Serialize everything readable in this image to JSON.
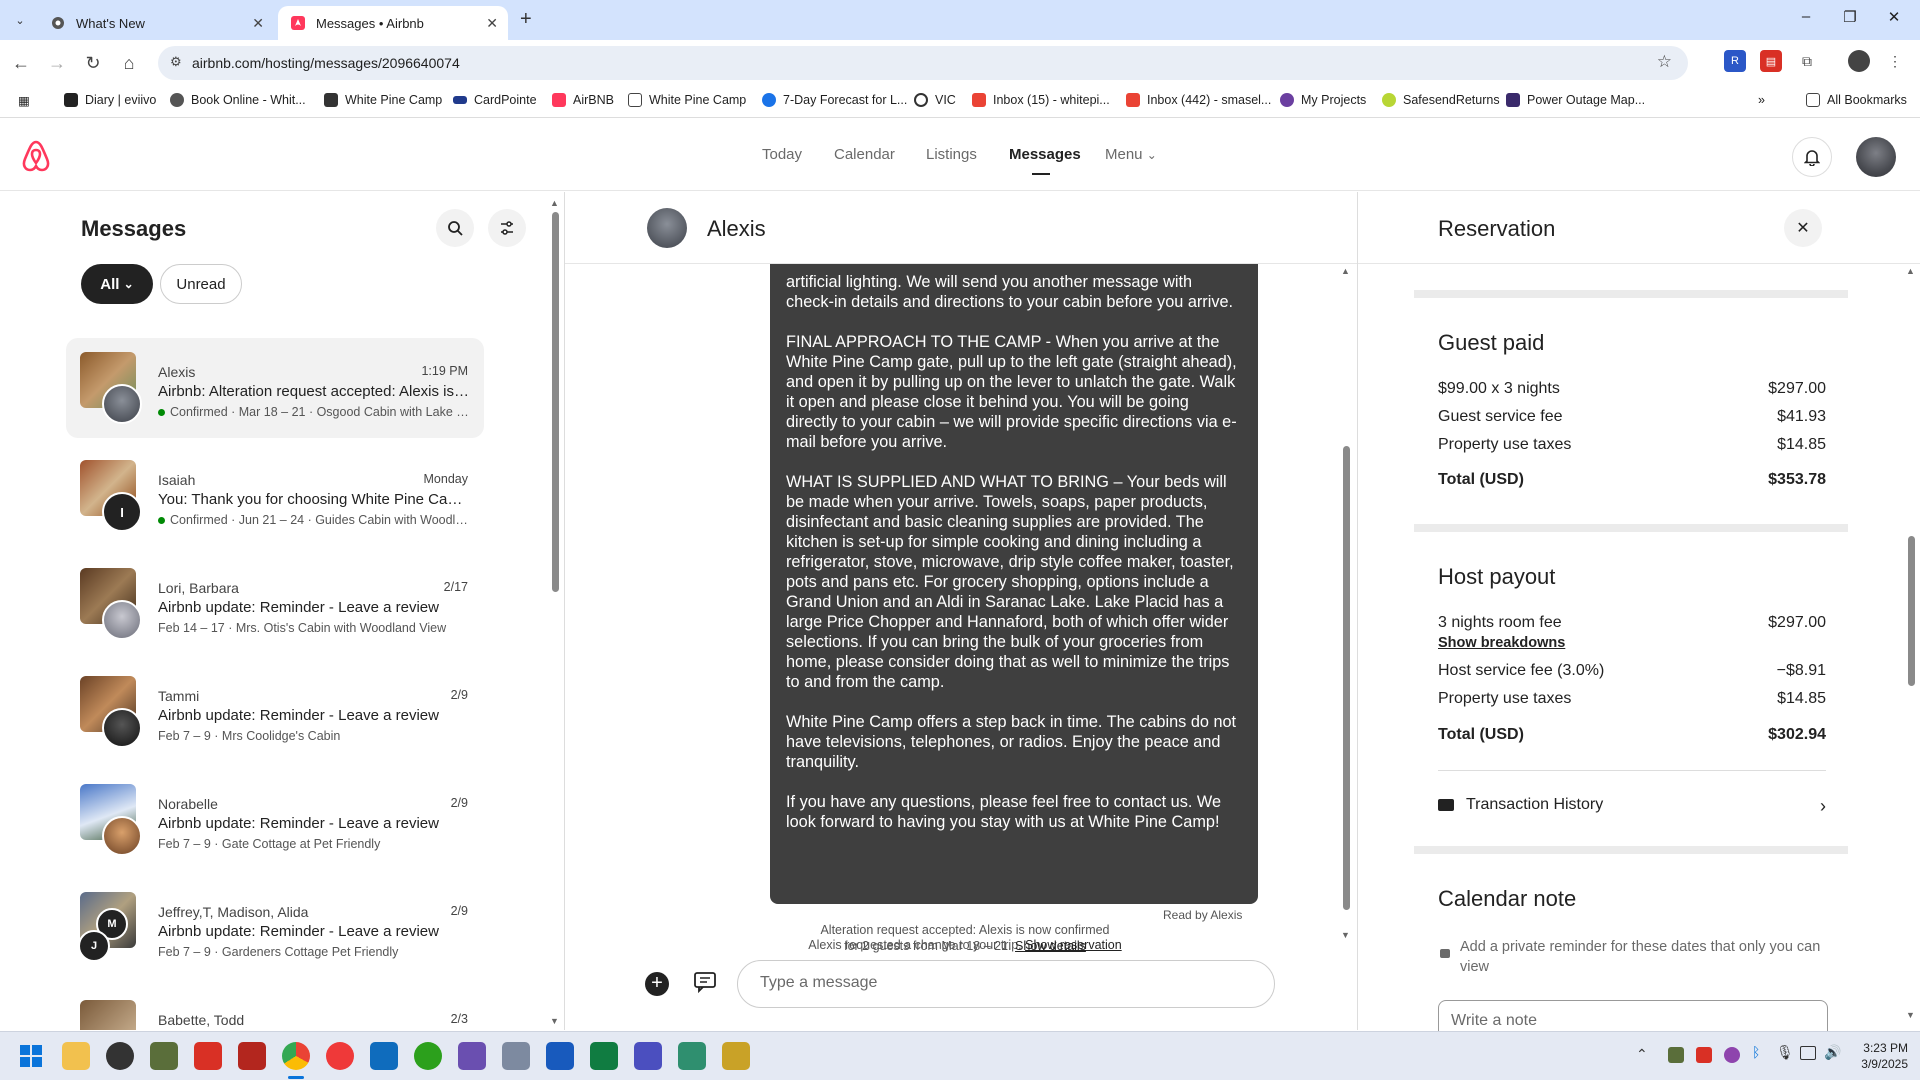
{
  "browser": {
    "tabs": [
      {
        "title": "What's New",
        "active": false
      },
      {
        "title": "Messages • Airbnb",
        "active": true
      }
    ],
    "url": "airbnb.com/hosting/messages/2096640074",
    "bookmarks": [
      "Diary | eviivo",
      "Book Online - Whit...",
      "White Pine Camp",
      "CardPointe",
      "AirBNB",
      "White Pine Camp",
      "7-Day Forecast for L...",
      "VIC",
      "Inbox (15) - whitepi...",
      "Inbox (442) - smasel...",
      "My Projects",
      "SafesendReturns",
      "Power Outage Map..."
    ],
    "all_bookmarks": "All Bookmarks"
  },
  "header": {
    "nav": [
      "Today",
      "Calendar",
      "Listings",
      "Messages",
      "Menu"
    ],
    "active_nav": "Messages"
  },
  "messages": {
    "title": "Messages",
    "filter_all": "All",
    "filter_unread": "Unread",
    "conversations": [
      {
        "name": "Alexis",
        "date": "1:19 PM",
        "line": "Airbnb: Alteration request accepted: Alexis is ...",
        "meta": "Confirmed · Mar 18 – 21 · Osgood Cabin with Lake Vi...",
        "confirmed": true
      },
      {
        "name": "Isaiah",
        "date": "Monday",
        "line": "You: Thank you for choosing White Pine Camp ...",
        "meta": "Confirmed · Jun 21 – 24 · Guides Cabin with Woodlan...",
        "confirmed": true,
        "initial": "I"
      },
      {
        "name": "Lori, Barbara",
        "date": "2/17",
        "line": "Airbnb update: Reminder - Leave a review",
        "meta": "Feb 14 – 17 · Mrs. Otis's Cabin with Woodland View"
      },
      {
        "name": "Tammi",
        "date": "2/9",
        "line": "Airbnb update: Reminder - Leave a review",
        "meta": "Feb 7 – 9 · Mrs Coolidge's Cabin"
      },
      {
        "name": "Norabelle",
        "date": "2/9",
        "line": "Airbnb update: Reminder - Leave a review",
        "meta": "Feb 7 – 9 · Gate Cottage at Pet Friendly"
      },
      {
        "name": "Jeffrey,T, Madison, Alida",
        "date": "2/9",
        "line": "Airbnb update: Reminder - Leave a review",
        "meta": "Feb 7 – 9 · Gardeners Cottage Pet Friendly",
        "initial": "M",
        "initial2": "J"
      },
      {
        "name": "Babette, Todd",
        "date": "2/3",
        "line": "",
        "meta": ""
      }
    ]
  },
  "chat": {
    "contact": "Alexis",
    "paragraphs": [
      "artificial lighting. We will send you another message with check-in details and directions to your cabin before you arrive.",
      "FINAL APPROACH TO THE CAMP - When you arrive at the White Pine Camp gate, pull up to the left gate (straight ahead), and open it by pulling up on the lever to unlatch the gate. Walk it open and please close it behind you. You will be going directly to your cabin – we will provide specific directions via e-mail before you arrive.",
      "WHAT IS SUPPLIED AND WHAT TO BRING – Your beds will be made when your arrive. Towels, soaps, paper products, disinfectant and basic cleaning supplies are provided. The kitchen is set-up for simple cooking and dining including a refrigerator, stove, microwave, drip style coffee maker, toaster, pots and pans etc. For grocery shopping, options include a Grand Union and an Aldi in Saranac Lake. Lake Placid has a large Price Chopper and Hannaford, both of which offer wider selections. If you can bring the bulk of your groceries from home, please consider doing that as well to minimize the trips to and from the camp.",
      "White Pine Camp offers a step back in time. The cabins do not have televisions, telephones, or radios. Enjoy the peace and tranquility.",
      "If you have any questions, please feel free to contact us. We look forward to having you stay with us at White Pine Camp!"
    ],
    "read_receipt": "Read by Alexis",
    "event1_text": "Alexis requested a change to your trip.",
    "event1_link": "Show reservation",
    "event2_line1": "Alteration request accepted: Alexis is now confirmed",
    "event2_line2": "for 2 guests from Mar 18 – 21.",
    "event2_link": "Show details",
    "input_placeholder": "Type a message"
  },
  "reservation": {
    "title": "Reservation",
    "guest_paid": {
      "heading": "Guest paid",
      "rows": [
        {
          "label": "$99.00 x 3 nights",
          "value": "$297.00"
        },
        {
          "label": "Guest service fee",
          "value": "$41.93"
        },
        {
          "label": "Property use taxes",
          "value": "$14.85"
        }
      ],
      "total_label": "Total (USD)",
      "total_value": "$353.78"
    },
    "host_payout": {
      "heading": "Host payout",
      "rows": [
        {
          "label": "3 nights room fee",
          "value": "$297.00"
        },
        {
          "label": "Host service fee (3.0%)",
          "value": "−$8.91"
        },
        {
          "label": "Property use taxes",
          "value": "$14.85"
        }
      ],
      "breakdown_link": "Show breakdowns",
      "total_label": "Total (USD)",
      "total_value": "$302.94"
    },
    "transaction_history": "Transaction History",
    "calendar_note": {
      "heading": "Calendar note",
      "hint": "Add a private reminder for these dates that only you can view",
      "placeholder": "Write a note"
    }
  },
  "taskbar": {
    "time": "3:23 PM",
    "date": "3/9/2025"
  },
  "colors": {
    "brand": "#ff385c",
    "tabstrip": "#d3e3fd",
    "bubble": "#3f3f3f",
    "confirmed": "#008a05"
  }
}
